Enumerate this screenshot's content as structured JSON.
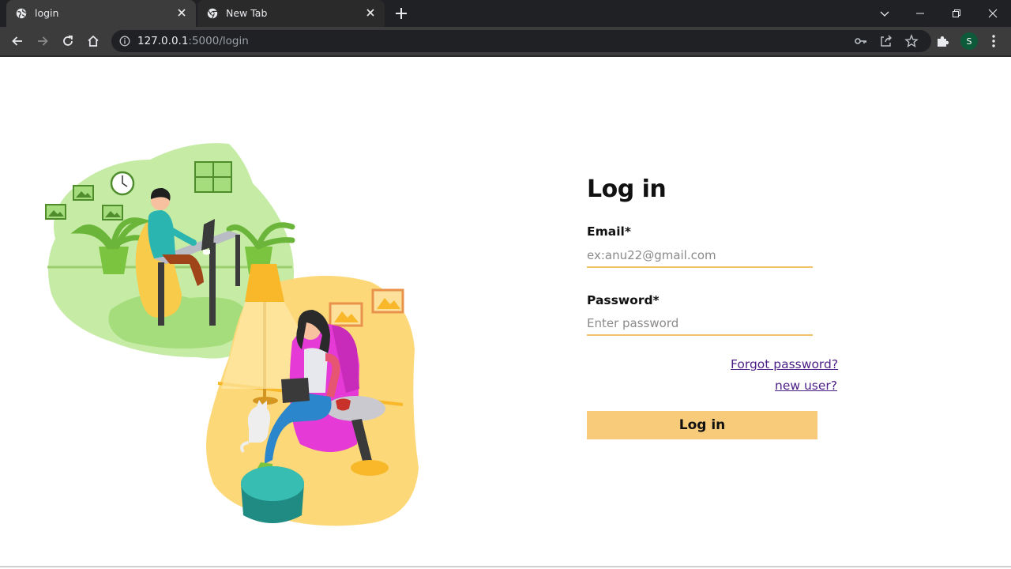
{
  "browser": {
    "tabs": [
      {
        "title": "login",
        "active": true
      },
      {
        "title": "New Tab",
        "active": false
      }
    ],
    "url_host": "127.0.0.1",
    "url_rest": ":5000/login",
    "profile_initial": "S"
  },
  "login": {
    "title": "Log in",
    "email_label": "Email*",
    "email_placeholder": "ex:anu22@gmail.com",
    "password_label": "Password*",
    "password_placeholder": "Enter password",
    "forgot_link": "Forgot password?",
    "new_user_link": "new user?",
    "submit_label": "Log in"
  },
  "colors": {
    "accent": "#f8cb7a",
    "input_underline": "#f0c36b",
    "link": "#4b1e86"
  }
}
